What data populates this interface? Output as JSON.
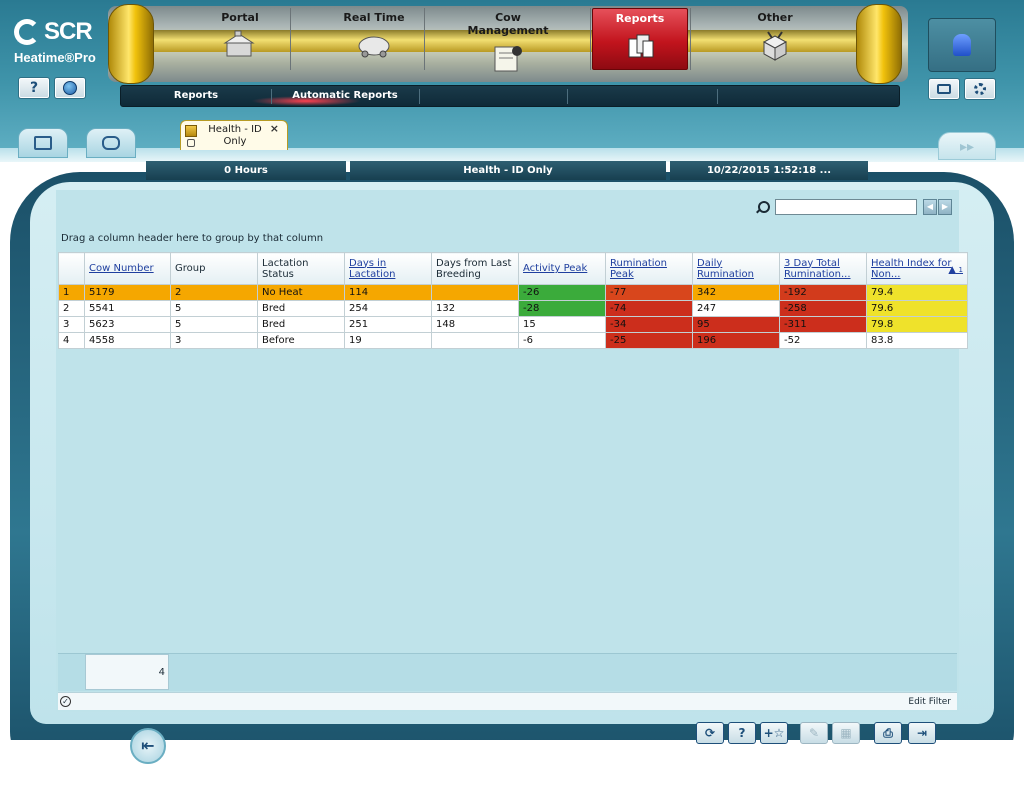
{
  "app": {
    "brand": "SCR",
    "product": "Heatime®Pro"
  },
  "top_buttons": {
    "help": "?",
    "globe": "globe-icon"
  },
  "nav": {
    "tabs": [
      {
        "label": "Portal",
        "icon": "portal-icon"
      },
      {
        "label": "Real Time",
        "icon": "real-time-icon"
      },
      {
        "label": "Cow Management",
        "icon": "cow-management-icon"
      },
      {
        "label": "Reports",
        "icon": "reports-icon",
        "active": true
      },
      {
        "label": "Other",
        "icon": "other-icon"
      }
    ],
    "subtabs": [
      {
        "label": "Reports",
        "active": true
      },
      {
        "label": "Automatic Reports"
      }
    ]
  },
  "doc_tab": {
    "label": "Health - ID Only",
    "close": "×"
  },
  "info": {
    "hours": "0 Hours",
    "report": "Health - ID Only",
    "datetime": "10/22/2015 1:52:18 ..."
  },
  "search": {
    "placeholder": "",
    "value": ""
  },
  "grid": {
    "group_hint": "Drag a column header here to group by that column",
    "columns": [
      {
        "label": "",
        "link": false
      },
      {
        "label": "Cow Number",
        "link": true
      },
      {
        "label": "Group",
        "link": false
      },
      {
        "label": "Lactation Status",
        "link": false
      },
      {
        "label": "Days in Lactation",
        "link": true
      },
      {
        "label": "Days from Last Breeding",
        "link": false
      },
      {
        "label": "Activity Peak",
        "link": true
      },
      {
        "label": "Rumination Peak",
        "link": true
      },
      {
        "label": "Daily Rumination",
        "link": true
      },
      {
        "label": "3 Day Total Rumination...",
        "link": true
      },
      {
        "label": "Health Index for Non...",
        "link": true
      }
    ],
    "sort_indicator": "▲",
    "sort_index": "1",
    "rows": [
      {
        "cells": [
          "1",
          "5179",
          "2",
          "No Heat",
          "114",
          "",
          "-26",
          "-77",
          "342",
          "-192",
          "79.4"
        ],
        "colors": [
          "#f5a700",
          "#f5a700",
          "#f5a700",
          "#f5a700",
          "#f5a700",
          "#f5a700",
          "#3bab3b",
          "#d8461c",
          "#f5a700",
          "#d23b1c",
          "#efe22b"
        ]
      },
      {
        "cells": [
          "2",
          "5541",
          "5",
          "Bred",
          "254",
          "132",
          "-28",
          "-74",
          "247",
          "-258",
          "79.6"
        ],
        "colors": [
          "",
          "",
          "",
          "",
          "",
          "",
          "#3bab3b",
          "#cc2e1c",
          "",
          "#cc2e1c",
          "#efe22b"
        ]
      },
      {
        "cells": [
          "3",
          "5623",
          "5",
          "Bred",
          "251",
          "148",
          "15",
          "-34",
          "95",
          "-311",
          "79.8"
        ],
        "colors": [
          "",
          "",
          "",
          "",
          "",
          "",
          "",
          "#cc2e1c",
          "#cc2e1c",
          "#cc2e1c",
          "#efe22b"
        ]
      },
      {
        "cells": [
          "4",
          "4558",
          "3",
          "Before",
          "19",
          "",
          "-6",
          "-25",
          "196",
          "-52",
          "83.8"
        ],
        "colors": [
          "",
          "",
          "",
          "",
          "",
          "",
          "",
          "#cc2e1c",
          "#cc2e1c",
          "",
          ""
        ]
      }
    ],
    "row_count": "4"
  },
  "status": {
    "edit_filter": "Edit Filter"
  },
  "bottom_buttons": [
    {
      "name": "refresh-button",
      "glyph": "⟳",
      "dim": false
    },
    {
      "name": "help-button",
      "glyph": "?",
      "dim": false
    },
    {
      "name": "add-favorite-button",
      "glyph": "+☆",
      "dim": false
    },
    {
      "name": "edit-button",
      "glyph": "✎",
      "dim": true
    },
    {
      "name": "calendar-button",
      "glyph": "▦",
      "dim": true
    },
    {
      "name": "print-button",
      "glyph": "⎙",
      "dim": false
    },
    {
      "name": "export-button",
      "glyph": "⇥",
      "dim": false
    }
  ],
  "colors": {
    "accent_red": "#c2141d",
    "frame_teal": "#2f7790",
    "row_orange": "#f5a700",
    "cell_green": "#3bab3b",
    "cell_red": "#cc2e1c",
    "cell_yellow": "#efe22b"
  }
}
